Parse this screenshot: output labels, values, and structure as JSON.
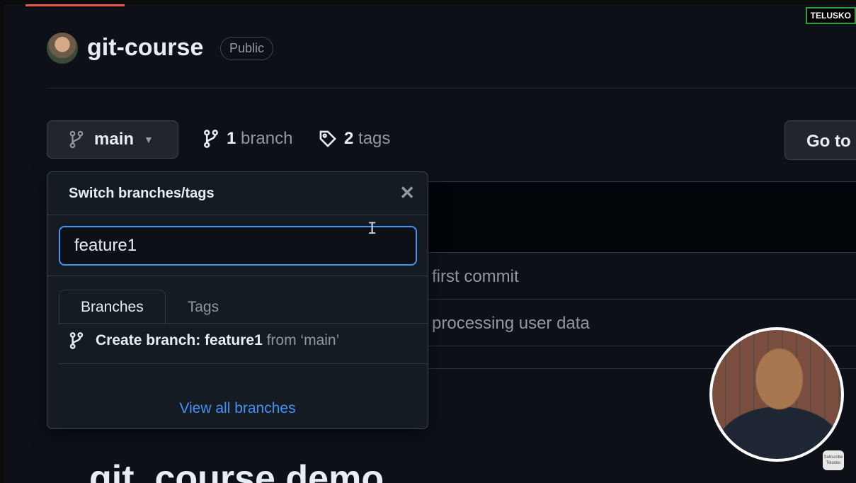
{
  "watermark": "TELUSKO",
  "repo": {
    "name": "git-course",
    "visibility": "Public"
  },
  "branch_button": {
    "label": "main"
  },
  "stats": {
    "branch_count": "1",
    "branch_label": "branch",
    "tag_count": "2",
    "tag_label": "tags"
  },
  "goto_button": "Go to",
  "commits": [
    "first commit",
    "processing user data"
  ],
  "readme_title": "git_course demo",
  "dropdown": {
    "title": "Switch branches/tags",
    "filter_value": "feature1",
    "tabs": [
      {
        "label": "Branches",
        "active": true
      },
      {
        "label": "Tags",
        "active": false
      }
    ],
    "create_prefix": "Create branch: feature1",
    "create_suffix": "from ‘main’",
    "view_all": "View all branches"
  },
  "webcam": {
    "subscribe_label": "Subscribe Telusko"
  },
  "colors": {
    "accent": "#4493f8",
    "background": "#0d1117",
    "panel": "#151b23"
  }
}
